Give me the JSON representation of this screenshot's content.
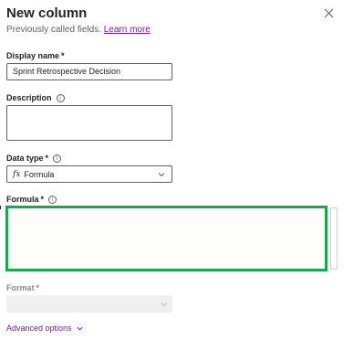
{
  "panel": {
    "title": "New column",
    "subtitle": "Previously called fields.",
    "learn_more": "Learn more"
  },
  "display_name": {
    "label": "Display name",
    "required_marker": "*",
    "value": "Sprint Retrospective Decision"
  },
  "description": {
    "label": "Description",
    "info_glyph": "i",
    "value": ""
  },
  "data_type": {
    "label": "Data type",
    "required_marker": "*",
    "info_glyph": "i",
    "icon_text": "fx",
    "selected": "Formula"
  },
  "formula": {
    "label": "Formula",
    "required_marker": "*",
    "info_glyph": "i",
    "value": "",
    "border_color": "#1ea64a"
  },
  "format": {
    "label": "Format",
    "required_marker": "*",
    "selected": ""
  },
  "advanced": {
    "label": "Advanced options"
  },
  "colors": {
    "link": "#7719aa",
    "focus_border": "#1ea64a",
    "text": "#242424"
  }
}
